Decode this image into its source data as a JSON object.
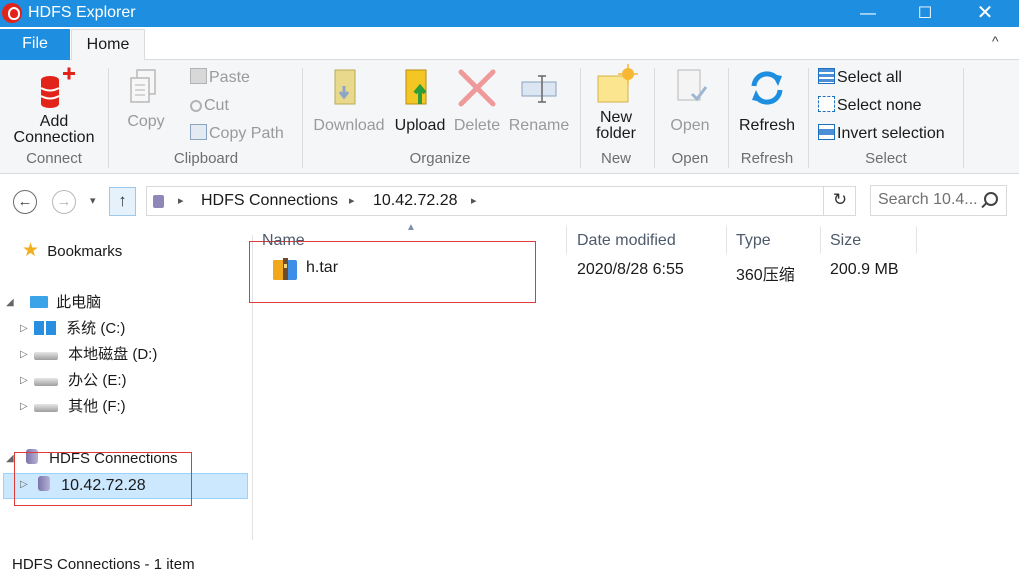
{
  "window": {
    "title": "HDFS Explorer",
    "min_glyph": "—",
    "max_glyph": "☐",
    "close_glyph": "✕"
  },
  "tabs": {
    "file": "File",
    "home": "Home",
    "collapse_glyph": "^"
  },
  "ribbon": {
    "connect": {
      "add_line1": "Add",
      "add_line2": "Connection",
      "group": "Connect"
    },
    "clipboard": {
      "copy": "Copy",
      "paste": "Paste",
      "cut": "Cut",
      "copy_path": "Copy Path",
      "group": "Clipboard"
    },
    "organize": {
      "download": "Download",
      "upload": "Upload",
      "delete": "Delete",
      "rename": "Rename",
      "group": "Organize"
    },
    "new": {
      "line1": "New",
      "line2": "folder",
      "group": "New"
    },
    "open": {
      "open": "Open",
      "group": "Open"
    },
    "refresh": {
      "refresh": "Refresh",
      "group": "Refresh"
    },
    "select": {
      "select_all": "Select all",
      "select_none": "Select none",
      "invert": "Invert selection",
      "group": "Select"
    }
  },
  "nav": {
    "back_glyph": "←",
    "forward_glyph": "→",
    "dropdown_glyph": "▾",
    "up_glyph": "↑",
    "chevron_glyph": "▸",
    "refresh_glyph": "↻",
    "breadcrumb": [
      "HDFS Connections",
      "10.42.72.28"
    ],
    "search_placeholder": "Search 10.4..."
  },
  "tree": {
    "bookmarks": "Bookmarks",
    "this_pc": "此电脑",
    "drives": [
      "系统 (C:)",
      "本地磁盘 (D:)",
      "办公 (E:)",
      "其他 (F:)"
    ],
    "hdfs_connections": "HDFS Connections",
    "connection": "10.42.72.28",
    "expanded_glyph": "◢",
    "collapsed_glyph": "▷",
    "star_glyph": "★"
  },
  "columns": {
    "name": "Name",
    "date": "Date modified",
    "type": "Type",
    "size": "Size",
    "sort_glyph": "▲"
  },
  "files": [
    {
      "name": "h.tar",
      "date": "2020/8/28 6:55",
      "type": "360压缩",
      "size": "200.9 MB"
    }
  ],
  "status": "HDFS Connections - 1 item",
  "colors": {
    "accent": "#1e8fe0",
    "selection": "#cce8ff",
    "highlight_box": "#e03a3a"
  }
}
